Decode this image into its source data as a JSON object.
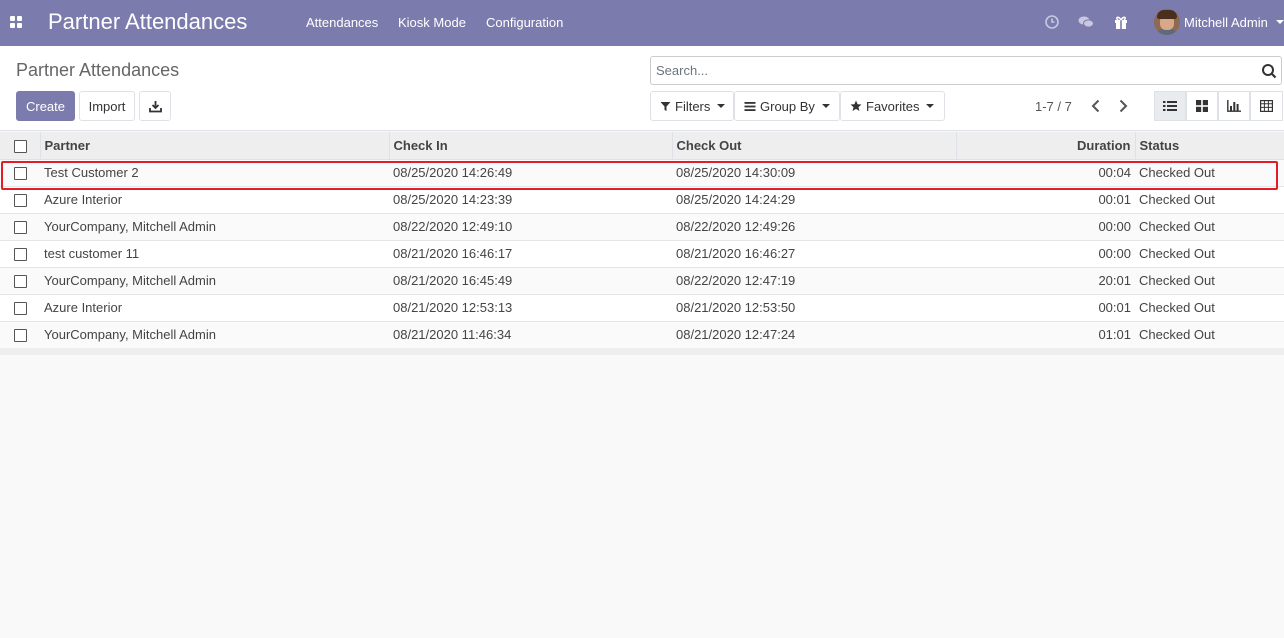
{
  "navbar": {
    "brand": "Partner Attendances",
    "menu": [
      "Attendances",
      "Kiosk Mode",
      "Configuration"
    ],
    "user": "Mitchell Admin"
  },
  "control_panel": {
    "title": "Partner Attendances",
    "create_label": "Create",
    "import_label": "Import",
    "search_placeholder": "Search...",
    "filters_label": "Filters",
    "group_by_label": "Group By",
    "favorites_label": "Favorites",
    "pager": "1-7 / 7"
  },
  "table": {
    "headers": {
      "partner": "Partner",
      "check_in": "Check In",
      "check_out": "Check Out",
      "duration": "Duration",
      "status": "Status"
    },
    "rows": [
      {
        "partner": "Test Customer 2",
        "check_in": "08/25/2020 14:26:49",
        "check_out": "08/25/2020 14:30:09",
        "duration": "00:04",
        "status": "Checked Out"
      },
      {
        "partner": "Azure Interior",
        "check_in": "08/25/2020 14:23:39",
        "check_out": "08/25/2020 14:24:29",
        "duration": "00:01",
        "status": "Checked Out"
      },
      {
        "partner": "YourCompany, Mitchell Admin",
        "check_in": "08/22/2020 12:49:10",
        "check_out": "08/22/2020 12:49:26",
        "duration": "00:00",
        "status": "Checked Out"
      },
      {
        "partner": "test customer 11",
        "check_in": "08/21/2020 16:46:17",
        "check_out": "08/21/2020 16:46:27",
        "duration": "00:00",
        "status": "Checked Out"
      },
      {
        "partner": "YourCompany, Mitchell Admin",
        "check_in": "08/21/2020 16:45:49",
        "check_out": "08/22/2020 12:47:19",
        "duration": "20:01",
        "status": "Checked Out"
      },
      {
        "partner": "Azure Interior",
        "check_in": "08/21/2020 12:53:13",
        "check_out": "08/21/2020 12:53:50",
        "duration": "00:01",
        "status": "Checked Out"
      },
      {
        "partner": "YourCompany, Mitchell Admin",
        "check_in": "08/21/2020 11:46:34",
        "check_out": "08/21/2020 12:47:24",
        "duration": "01:01",
        "status": "Checked Out"
      }
    ]
  },
  "colors": {
    "brand": "#7c7bad",
    "highlight": "#e11d2b"
  },
  "icons": [
    "apps-icon",
    "clock-icon",
    "chat-icon",
    "gift-icon",
    "download-icon",
    "search-icon",
    "filter-icon",
    "group-by-icon",
    "star-icon",
    "chevron-left-icon",
    "chevron-right-icon",
    "list-view-icon",
    "kanban-view-icon",
    "graph-view-icon",
    "pivot-view-icon"
  ]
}
